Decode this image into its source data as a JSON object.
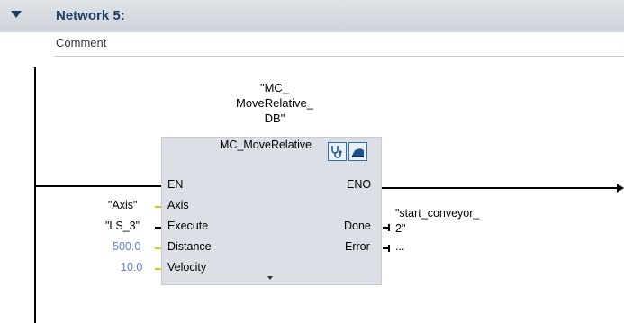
{
  "network": {
    "title": "Network 5:",
    "comment": "Comment"
  },
  "block": {
    "instance_db": "\"MC_\nMoveRelative_\nDB\"",
    "type_name": "MC_MoveRelative",
    "pins_left": [
      "EN",
      "Axis",
      "Execute",
      "Distance",
      "Velocity"
    ],
    "pins_right": [
      "ENO",
      "Done",
      "Error"
    ],
    "inputs": {
      "axis": "\"Axis\"",
      "execute": "\"LS_3\"",
      "distance": "500.0",
      "velocity": "10.0"
    },
    "outputs": {
      "done": "\"start_conveyor_\n2\"",
      "error": "..."
    }
  },
  "icons": {
    "diagnostics": "stethoscope-icon",
    "commissioning": "commissioning-icon"
  },
  "colors": {
    "header_bg": "#d6dae0",
    "title": "#1e3f66",
    "block_bg": "#dcdfe6",
    "constant_text": "#5a7fd0",
    "input_marker": "#e5c012"
  }
}
